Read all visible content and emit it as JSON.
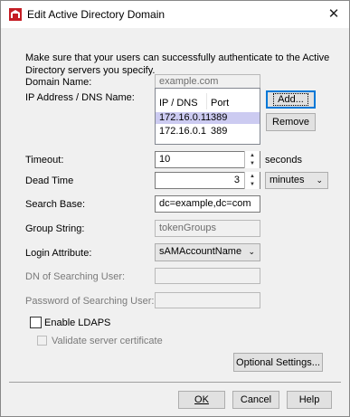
{
  "window": {
    "title": "Edit Active Directory Domain",
    "close_glyph": "✕",
    "app_icon": "firebox-red-icon"
  },
  "intro": "Make sure that your users can successfully authenticate to the Active Directory servers you specify.",
  "domain": {
    "label": "Domain Name:",
    "placeholder": "example.com"
  },
  "servers": {
    "label": "IP Address / DNS Name:",
    "columns": [
      "IP / DNS",
      "Port"
    ],
    "rows": [
      {
        "ip": "172.16.0.11",
        "port": "389",
        "selected": true
      },
      {
        "ip": "172.16.0.1",
        "port": "389",
        "selected": false
      }
    ],
    "add_label": "Add...",
    "remove_label": "Remove"
  },
  "timeout": {
    "label": "Timeout:",
    "value": "10",
    "unit": "seconds"
  },
  "dead_time": {
    "label": "Dead Time",
    "value": "3",
    "unit_selected": "minutes"
  },
  "search_base": {
    "label": "Search Base:",
    "value": "dc=example,dc=com"
  },
  "group_string": {
    "label": "Group String:",
    "placeholder": "tokenGroups"
  },
  "login_attribute": {
    "label": "Login Attribute:",
    "selected": "sAMAccountName"
  },
  "dn_searching_user": {
    "label": "DN of Searching User:",
    "value": ""
  },
  "password_searching_user": {
    "label": "Password of Searching User:",
    "value": ""
  },
  "enable_ldaps": {
    "label": "Enable LDAPS",
    "checked": false
  },
  "validate_cert": {
    "label": "Validate server certificate",
    "checked": false
  },
  "buttons": {
    "optional_settings": "Optional Settings...",
    "ok": "OK",
    "cancel": "Cancel",
    "help": "Help"
  }
}
